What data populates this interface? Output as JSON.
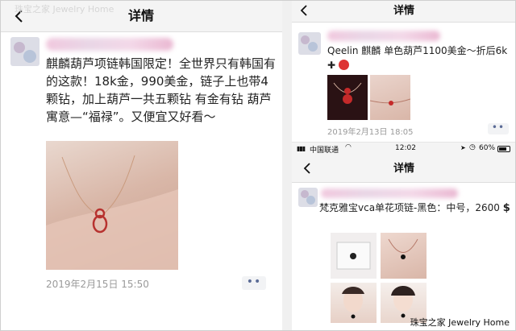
{
  "watermark_top": "珠宝之家 Jewelry Home",
  "watermark_bottom": "珠宝之家 Jewelry Home",
  "left": {
    "nav_title": "详情",
    "post_text": "麒麟葫芦项链韩国限定！全世界只有韩国有的这款！18k金，990美金，链子上也带4颗钻，加上葫芦一共五颗钻 有金有钻 葫芦寓意—“福禄”。又便宜又好看～",
    "timestamp": "2019年2月15日 15:50",
    "more": "••"
  },
  "right_top": {
    "nav_title": "详情",
    "post_text": "Qeelin 麒麟 单色葫芦1100美金～折后6k",
    "timestamp": "2019年2月13日 18:05",
    "more": "••"
  },
  "right_bottom": {
    "status": {
      "carrier": "中国联通",
      "time": "12:02",
      "battery": "60%"
    },
    "nav_title": "详情",
    "post_text": "梵克雅宝vca单花项链-黑色：中号，2600"
  },
  "colors": {
    "nav_bg": "#f4f4f4",
    "meta_text": "#9a9a9a",
    "more_dots": "#5b6b96"
  }
}
